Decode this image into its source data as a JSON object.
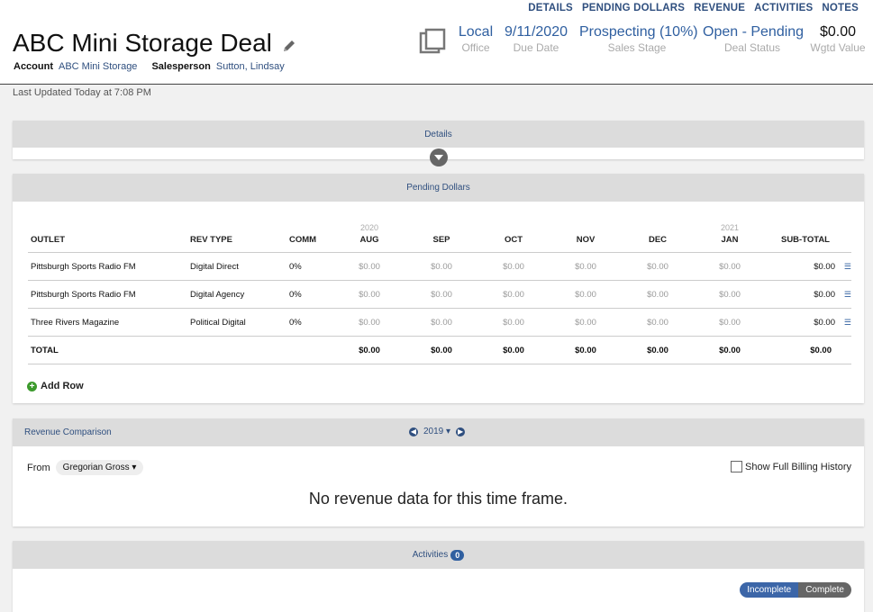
{
  "nav": [
    "DETAILS",
    "PENDING DOLLARS",
    "REVENUE",
    "ACTIVITIES",
    "NOTES"
  ],
  "deal": {
    "title": "ABC Mini Storage Deal",
    "account_label": "Account",
    "account": "ABC Mini Storage",
    "salesperson_label": "Salesperson",
    "salesperson": "Sutton, Lindsay",
    "last_updated": "Last Updated Today at 7:08 PM"
  },
  "stats": [
    {
      "value": "Local",
      "label": "Office"
    },
    {
      "value": "9/11/2020",
      "label": "Due Date"
    },
    {
      "value": "Prospecting (10%)",
      "label": "Sales Stage"
    },
    {
      "value": "Open - Pending",
      "label": "Deal Status"
    },
    {
      "value": "$0.00",
      "label": "Wgtd Value"
    }
  ],
  "details": {
    "title": "Details"
  },
  "pending": {
    "title": "Pending Dollars",
    "columns": {
      "outlet": "OUTLET",
      "rev_type": "REV TYPE",
      "comm": "COMM",
      "aug": "AUG",
      "sep": "SEP",
      "oct": "OCT",
      "nov": "NOV",
      "dec": "DEC",
      "jan": "JAN",
      "subtotal": "SUB-TOTAL"
    },
    "year_2020": "2020",
    "year_2021": "2021",
    "rows": [
      {
        "outlet": "Pittsburgh Sports Radio FM",
        "rev_type": "Digital Direct",
        "comm": "0%",
        "aug": "$0.00",
        "sep": "$0.00",
        "oct": "$0.00",
        "nov": "$0.00",
        "dec": "$0.00",
        "jan": "$0.00",
        "subtotal": "$0.00"
      },
      {
        "outlet": "Pittsburgh Sports Radio FM",
        "rev_type": "Digital Agency",
        "comm": "0%",
        "aug": "$0.00",
        "sep": "$0.00",
        "oct": "$0.00",
        "nov": "$0.00",
        "dec": "$0.00",
        "jan": "$0.00",
        "subtotal": "$0.00"
      },
      {
        "outlet": "Three Rivers Magazine",
        "rev_type": "Political Digital",
        "comm": "0%",
        "aug": "$0.00",
        "sep": "$0.00",
        "oct": "$0.00",
        "nov": "$0.00",
        "dec": "$0.00",
        "jan": "$0.00",
        "subtotal": "$0.00"
      }
    ],
    "total": {
      "label": "TOTAL",
      "aug": "$0.00",
      "sep": "$0.00",
      "oct": "$0.00",
      "nov": "$0.00",
      "dec": "$0.00",
      "jan": "$0.00",
      "subtotal": "$0.00"
    },
    "add_row": "Add Row"
  },
  "revenue": {
    "title": "Revenue Comparison",
    "year": "2019",
    "from_label": "From",
    "from_value": "Gregorian Gross",
    "billing_label": "Show Full Billing History",
    "empty": "No revenue data for this time frame."
  },
  "activities": {
    "title": "Activities",
    "count": "0",
    "incomplete": "Incomplete",
    "complete": "Complete"
  },
  "colors": {
    "accent": "#2f4f7f",
    "link": "#2f5fa0",
    "add": "#3c9a2c"
  }
}
